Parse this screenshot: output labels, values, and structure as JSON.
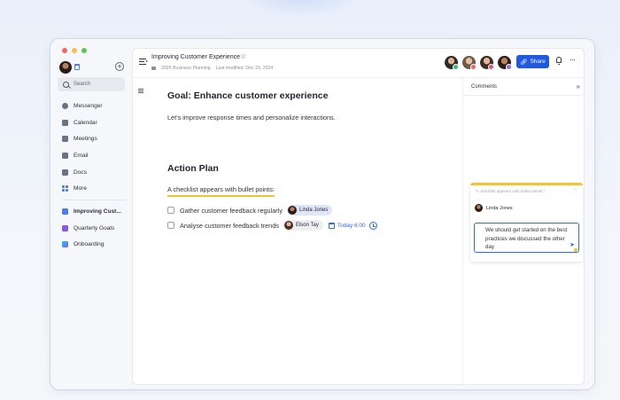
{
  "sidebar": {
    "search_placeholder": "Search",
    "items": [
      {
        "label": "Messenger",
        "icon": "chat-icon"
      },
      {
        "label": "Calendar",
        "icon": "calendar-icon"
      },
      {
        "label": "Meetings",
        "icon": "video-icon"
      },
      {
        "label": "Email",
        "icon": "mail-icon"
      },
      {
        "label": "Docs",
        "icon": "docs-icon"
      },
      {
        "label": "More",
        "icon": "grid-icon"
      }
    ],
    "docs": [
      {
        "label": "Improving Cust...",
        "color": "#4a7de8",
        "active": true
      },
      {
        "label": "Quarterly Goals",
        "color": "#8a5bd8",
        "active": false
      },
      {
        "label": "Onboarding",
        "color": "#3aa8e0",
        "active": false
      }
    ]
  },
  "header": {
    "title": "Improving Customer Experience",
    "folder": "2025 Business Planning",
    "modified": "Last modified: Dec 29, 2024",
    "share_label": "Share",
    "more_label": "···"
  },
  "doc": {
    "goal_heading": "Goal: Enhance customer experience",
    "goal_text": "Let’s improve response times and personalize interactions.",
    "plan_heading": "Action Plan",
    "checklist_label": "A checklist appears with bullet points:",
    "tasks": [
      {
        "text": "Gather customer feedback regularly",
        "assignee": "Linda Jones"
      },
      {
        "text": "Analyse customer feedback trends",
        "assignee": "Elson Tay",
        "due": "Today 6:00"
      }
    ]
  },
  "comments": {
    "title": "Comments",
    "collapse": "»",
    "quote": "\"A checklist appears with bullet points:\"",
    "card_more": "···",
    "author": "Linda Jones",
    "reply_text": "We should get started on the best practices we discussed the other day"
  },
  "colors": {
    "accent": "#1f5ae0",
    "highlight": "#f4c430"
  }
}
